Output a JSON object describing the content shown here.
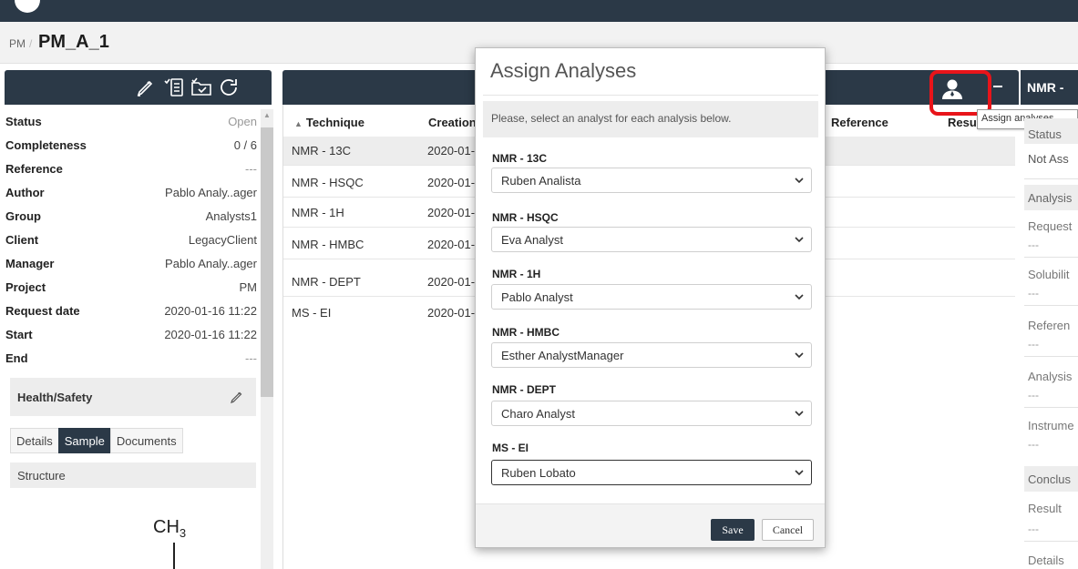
{
  "breadcrumb": {
    "parent": "PM",
    "separator": "/",
    "title": "PM_A_1"
  },
  "properties": [
    {
      "key": "Status",
      "value": "Open"
    },
    {
      "key": "Completeness",
      "value": "0 / 6"
    },
    {
      "key": "Reference",
      "value": "---"
    },
    {
      "key": "Author",
      "value": "Pablo Analy..ager"
    },
    {
      "key": "Group",
      "value": "Analysts1"
    },
    {
      "key": "Client",
      "value": "LegacyClient"
    },
    {
      "key": "Manager",
      "value": "Pablo Analy..ager"
    },
    {
      "key": "Project",
      "value": "PM"
    },
    {
      "key": "Request date",
      "value": "2020-01-16 11:22"
    },
    {
      "key": "Start",
      "value": "2020-01-16 11:22"
    },
    {
      "key": "End",
      "value": "---"
    }
  ],
  "health_safety": {
    "label": "Health/Safety"
  },
  "tabs": [
    "Details",
    "Sample",
    "Documents"
  ],
  "structure": {
    "label": "Structure",
    "formula_main": "CH",
    "formula_sub": "3"
  },
  "table": {
    "headers": {
      "technique": "Technique",
      "creation": "Creation",
      "reference": "Reference",
      "result": "Resul"
    },
    "rows": [
      {
        "technique": "NMR - 13C",
        "creation": "2020-01-"
      },
      {
        "technique": "NMR - HSQC",
        "creation": "2020-01-"
      },
      {
        "technique": "NMR - 1H",
        "creation": "2020-01-"
      },
      {
        "technique": "NMR - HMBC",
        "creation": "2020-01-"
      },
      {
        "technique": "NMR - DEPT",
        "creation": "2020-01-"
      },
      {
        "technique": "MS - EI",
        "creation": "2020-01-"
      }
    ]
  },
  "tooltip": "Assign analyses",
  "right_panel": {
    "title": "NMR -",
    "status_header": "Status",
    "status_value": "Not Ass",
    "analysis_header": "Analysis",
    "fields": [
      {
        "label": "Request",
        "value": "---"
      },
      {
        "label": "Solubilit",
        "value": "---"
      },
      {
        "label": "Referen",
        "value": "---"
      },
      {
        "label": "Analysis",
        "value": "---"
      },
      {
        "label": "Instrume",
        "value": "---"
      }
    ],
    "conclusion_header": "Conclus",
    "result_label": "Result",
    "result_value": "---",
    "details_label": "Details"
  },
  "modal": {
    "title": "Assign Analyses",
    "instruction": "Please, select an analyst for each analysis below.",
    "assignments": [
      {
        "analysis": "NMR - 13C",
        "analyst": "Ruben Analista"
      },
      {
        "analysis": "NMR - HSQC",
        "analyst": "Eva Analyst"
      },
      {
        "analysis": "NMR - 1H",
        "analyst": "Pablo Analyst"
      },
      {
        "analysis": "NMR - HMBC",
        "analyst": "Esther AnalystManager"
      },
      {
        "analysis": "NMR - DEPT",
        "analyst": "Charo Analyst"
      },
      {
        "analysis": "MS - EI",
        "analyst": "Ruben Lobato"
      }
    ],
    "save_label": "Save",
    "cancel_label": "Cancel"
  },
  "colors": {
    "header_dark": "#2b3947",
    "highlight_red": "#e8141a",
    "panel_gray": "#ededed"
  },
  "icons": [
    "edit-icon",
    "checklist-icon",
    "folder-icon",
    "refresh-icon",
    "assign-user-icon",
    "chevron-down-icon"
  ]
}
